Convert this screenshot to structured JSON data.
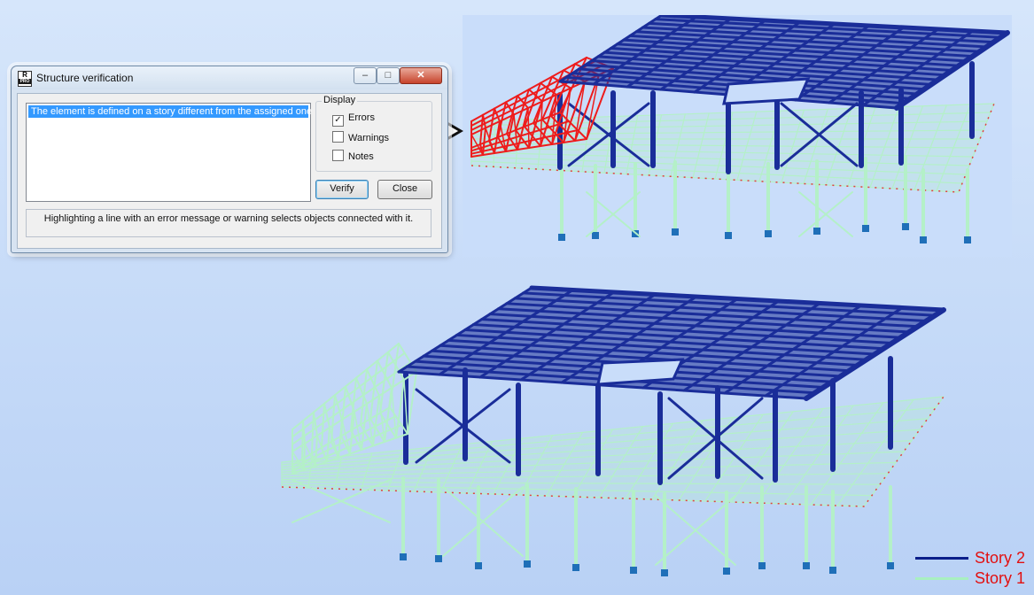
{
  "dialog": {
    "title": "Structure verification",
    "messages": [
      "The element is defined on a story different from the assigned one"
    ],
    "display_group_label": "Display",
    "options": [
      {
        "label": "Errors",
        "checked": true
      },
      {
        "label": "Warnings",
        "checked": false
      },
      {
        "label": "Notes",
        "checked": false
      }
    ],
    "verify_label": "Verify",
    "close_label": "Close",
    "info_text": "Highlighting a line with an error message or warning selects objects connected with it.",
    "window_buttons": {
      "minimize": "–",
      "maximize": "□",
      "close": "✕"
    }
  },
  "legend": [
    {
      "label": "Story 2",
      "color": "#0b1e8a"
    },
    {
      "label": "Story 1",
      "color": "#a8f0c0"
    }
  ],
  "colors": {
    "story2": "#1a2d99",
    "story1": "#b4f0c8",
    "error": "#ee1c1c",
    "legend_text": "#e21010"
  }
}
